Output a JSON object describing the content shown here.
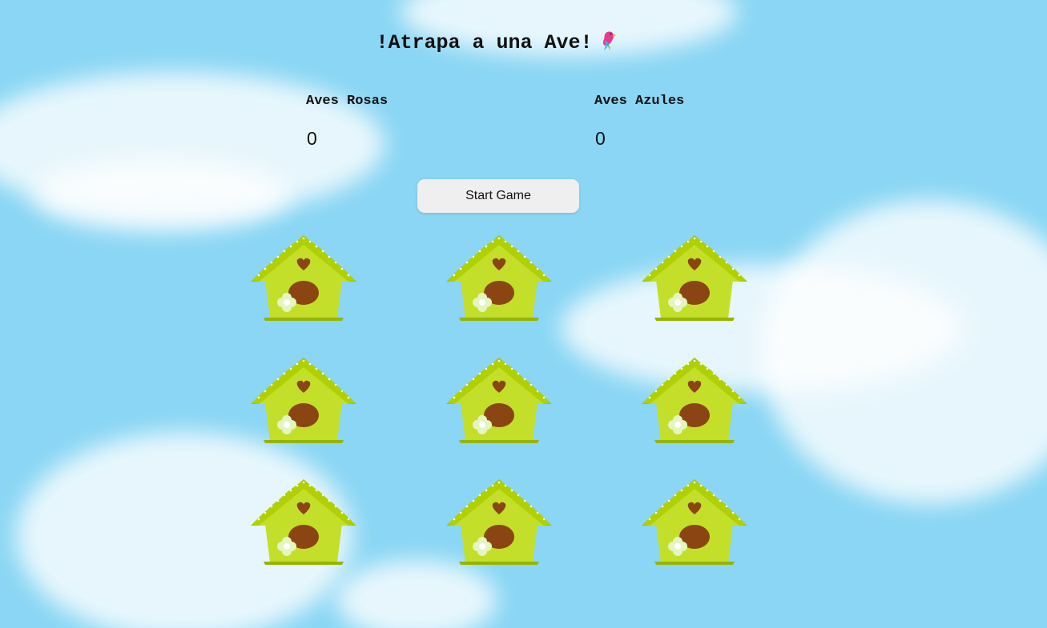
{
  "game": {
    "title": "!Atrapa a una Ave!",
    "title_icon": "parrot-icon"
  },
  "scoreboard": {
    "pink": {
      "label": "Aves Rosas",
      "score": "0"
    },
    "blue": {
      "label": "Aves Azules",
      "score": "0"
    }
  },
  "controls": {
    "start_label": "Start Game"
  },
  "holes": {
    "count": 9,
    "icon": "birdhouse-icon"
  },
  "colors": {
    "sky": "#8ad6f4",
    "house_body": "#c3df2a",
    "house_roof": "#a3c400",
    "house_hole": "#8b4513",
    "button_bg": "#efefef"
  }
}
